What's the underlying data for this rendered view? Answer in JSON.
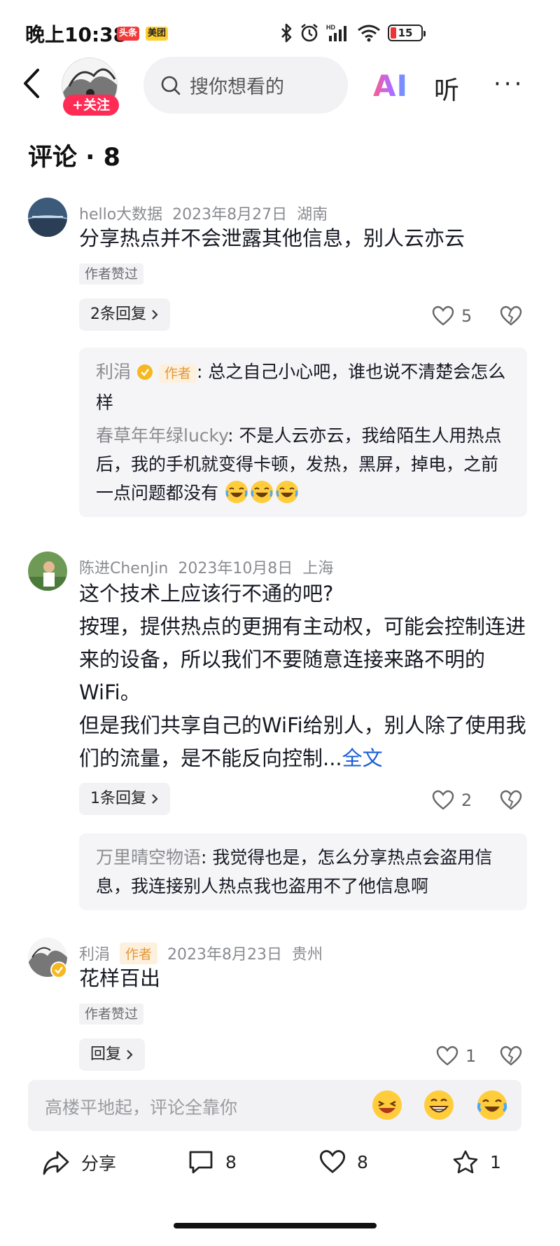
{
  "status_bar": {
    "time": "晚上10:38",
    "app_badges": [
      "头条",
      "美团"
    ],
    "battery": "15",
    "signal_label": "HD"
  },
  "nav": {
    "follow_label": "+关注",
    "search_placeholder": "搜你想看的",
    "ai_label": "AI",
    "listen_label": "听",
    "more_label": "···"
  },
  "header": {
    "title": "评论 · 8"
  },
  "comments": [
    {
      "username": "hello大数据",
      "date": "2023年8月27日",
      "location": "湖南",
      "text": "分享热点并不会泄露其他信息，别人云亦云",
      "liked_tag": "作者赞过",
      "reply_label": "2条回复",
      "likes": "5",
      "replies": [
        {
          "name": "利涓",
          "tag": "作者",
          "text": ": 总之自己小心吧，谁也说不清楚会怎么样"
        },
        {
          "name": "春草年年绿lucky",
          "text": ": 不是人云亦云，我给陌生人用热点后，我的手机就变得卡顿，发热，黑屏，掉电，之前一点问题都没有"
        }
      ]
    },
    {
      "username": "陈进ChenJin",
      "date": "2023年10月8日",
      "location": "上海",
      "text_lines": [
        "这个技术上应该行不通的吧?",
        "按理，提供热点的更拥有主动权，可能会控制连进来的设备，所以我们不要随意连接来路不明的WiFi。",
        "但是我们共享自己的WiFi给别人，别人除了使用我们的流量，是不能反向控制..."
      ],
      "full_text_label": "全文",
      "reply_label": "1条回复",
      "likes": "2",
      "replies": [
        {
          "name": "万里晴空物语",
          "text": ": 我觉得也是，怎么分享热点会盗用信息，我连接别人热点我也盗用不了他信息啊"
        }
      ]
    },
    {
      "username": "利涓",
      "author_tag": "作者",
      "date": "2023年8月23日",
      "location": "贵州",
      "text": "花样百出",
      "liked_tag": "作者赞过",
      "reply_label": "回复",
      "likes": "1"
    }
  ],
  "input": {
    "placeholder": "高楼平地起，评论全靠你"
  },
  "actions": {
    "share_label": "分享",
    "comment_count": "8",
    "like_count": "8",
    "favorite_count": "1"
  },
  "colors": {
    "follow": "#fe2c55",
    "author_tag_bg": "#fdf0dc",
    "author_tag_text": "#e2983b",
    "link": "#1b5fd6"
  }
}
